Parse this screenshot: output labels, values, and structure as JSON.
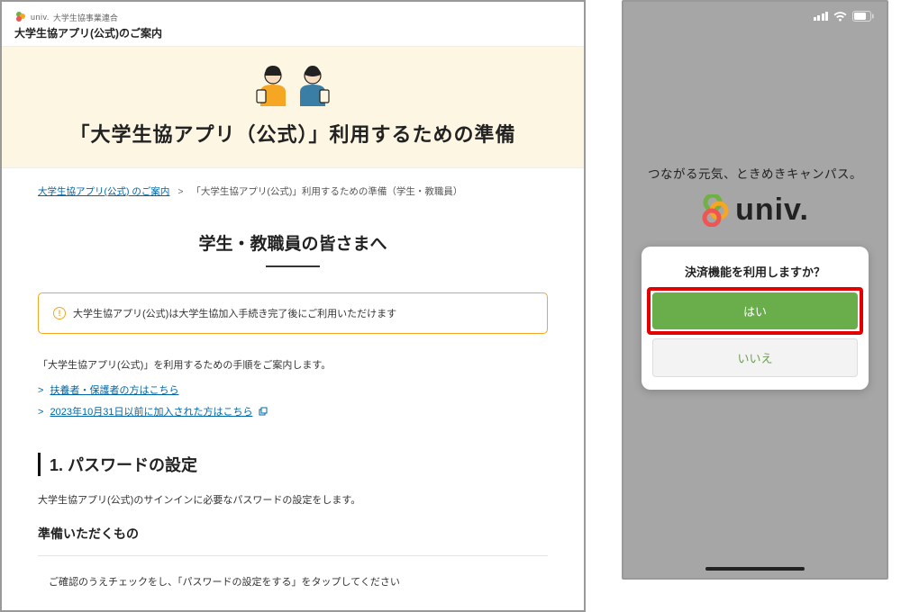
{
  "left": {
    "header_sub": "大学生協事業連合",
    "header_title": "大学生協アプリ(公式)のご案内",
    "logo_text": "univ.",
    "hero_title": "「大学生協アプリ（公式）」利用するための準備",
    "breadcrumb_link": "大学生協アプリ(公式) のご案内",
    "breadcrumb_sep": ">",
    "breadcrumb_current": "「大学生協アプリ(公式)」利用するための準備（学生・教職員）",
    "sub_heading": "学生・教職員の皆さまへ",
    "alert_text": "大学生協アプリ(公式)は大学生協加入手続き完了後にご利用いただけます",
    "alert_icon": "!",
    "desc": "「大学生協アプリ(公式)」を利用するための手順をご案内します。",
    "link1": "扶養者・保護者の方はこちら",
    "link2": "2023年10月31日以前に加入された方はこちら",
    "link_arrow": ">",
    "sect_head": "1. パスワードの設定",
    "sect_desc": "大学生協アプリ(公式)のサインインに必要なパスワードの設定をします。",
    "sub_h": "準備いただくもの",
    "check_line": "ご確認のうえチェックをし、「パスワードの設定をする」をタップしてください"
  },
  "right": {
    "splash_tag": "つながる元気、ときめきキャンパス。",
    "splash_text": "univ.",
    "dialog_title": "決済機能を利用しますか？",
    "btn_yes": "はい",
    "btn_no": "いいえ"
  }
}
